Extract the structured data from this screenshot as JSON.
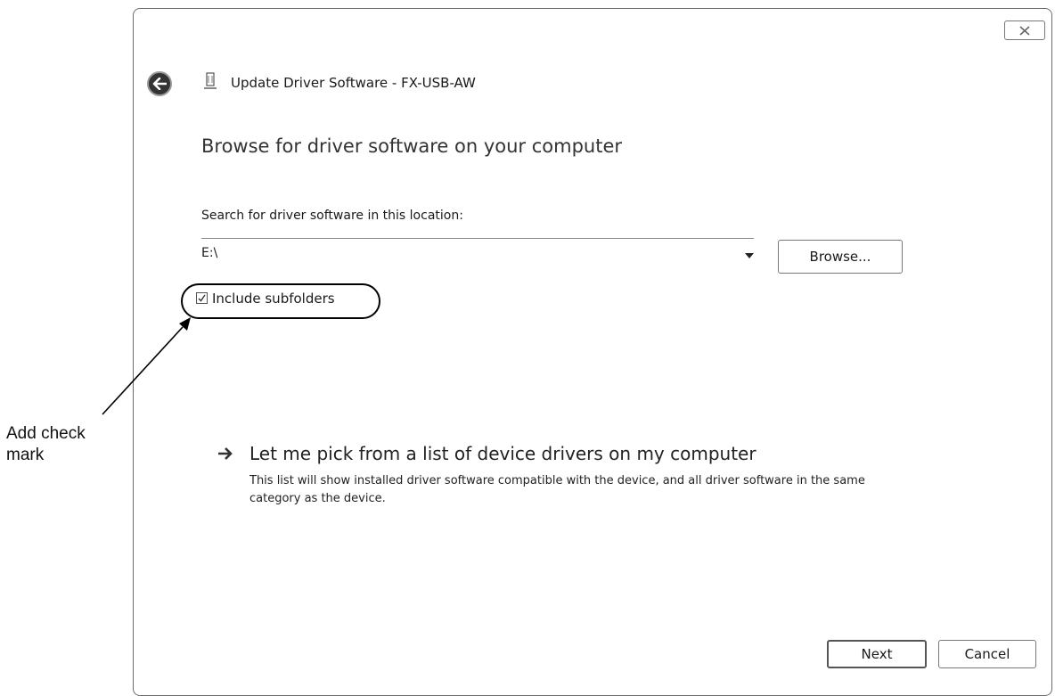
{
  "dialog": {
    "title": "Update Driver Software - FX-USB-AW",
    "heading": "Browse for driver software on your computer",
    "icons": {
      "back": "back-arrow-icon",
      "device": "usb-device-icon",
      "close": "close-icon"
    }
  },
  "search": {
    "label": "Search for driver software in this location:",
    "path_value": "E:\\",
    "browse_label": "Browse...",
    "include_subfolders_label": "Include subfolders",
    "include_subfolders_checked": true
  },
  "pick_option": {
    "title": "Let me pick from a list of device drivers on my computer",
    "description": "This list will show installed driver software compatible with the device, and all driver software in the same category as the device."
  },
  "buttons": {
    "next": "Next",
    "cancel": "Cancel"
  },
  "annotation": {
    "text": "Add check mark"
  }
}
